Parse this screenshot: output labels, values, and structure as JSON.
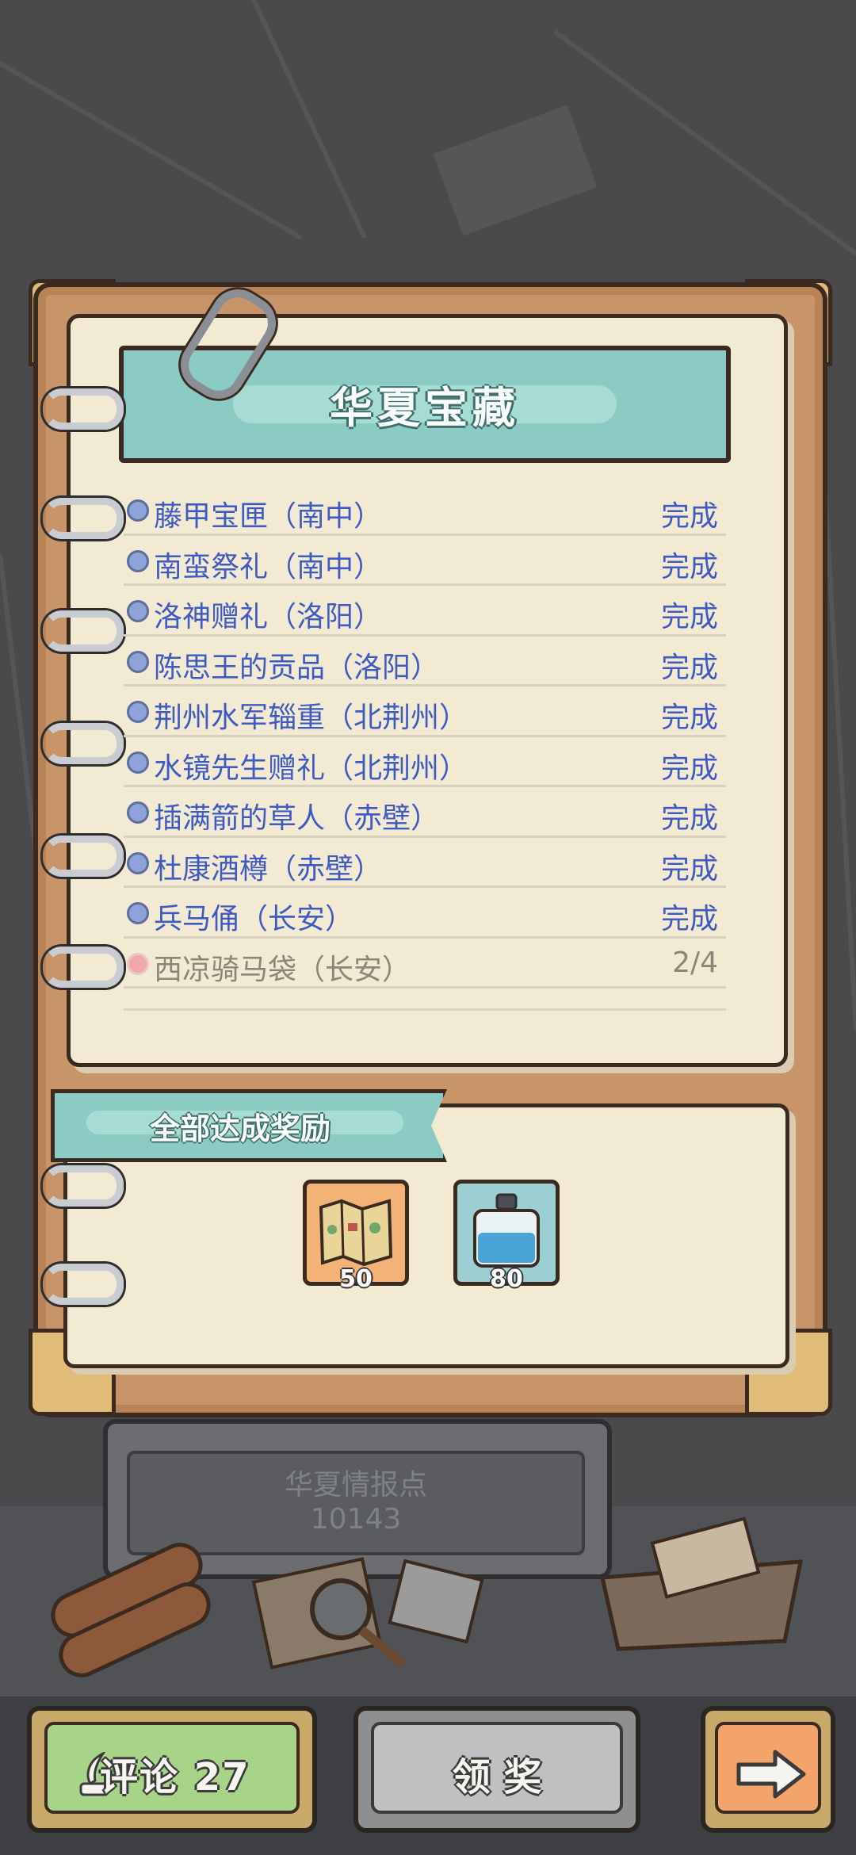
{
  "album": {
    "title": "华夏宝藏",
    "items": [
      {
        "label": "藤甲宝匣（南中）",
        "status": "完成",
        "done": true
      },
      {
        "label": "南蛮祭礼（南中）",
        "status": "完成",
        "done": true
      },
      {
        "label": "洛神赠礼（洛阳）",
        "status": "完成",
        "done": true
      },
      {
        "label": "陈思王的贡品（洛阳）",
        "status": "完成",
        "done": true
      },
      {
        "label": "荆州水军辎重（北荆州）",
        "status": "完成",
        "done": true
      },
      {
        "label": "水镜先生赠礼（北荆州）",
        "status": "完成",
        "done": true
      },
      {
        "label": "插满箭的草人（赤壁）",
        "status": "完成",
        "done": true
      },
      {
        "label": "杜康酒樽（赤壁）",
        "status": "完成",
        "done": true
      },
      {
        "label": "兵马俑（长安）",
        "status": "完成",
        "done": true
      },
      {
        "label": "西凉骑马袋（长安）",
        "status": "2/4",
        "done": false
      }
    ]
  },
  "reward": {
    "banner": "全部达成奖励",
    "items": [
      {
        "icon": "treasure-map-icon",
        "count": "50"
      },
      {
        "icon": "ink-bottle-icon",
        "count": "80"
      }
    ]
  },
  "intel": {
    "title": "华夏情报点",
    "value": "10143"
  },
  "buttons": {
    "comment": "评论 27",
    "claim": "领 奖",
    "next_icon": "arrow-right-icon"
  },
  "colors": {
    "done_text": "#3f5bc2",
    "pending_text": "#8c8579",
    "banner": "#8ccbc4"
  }
}
